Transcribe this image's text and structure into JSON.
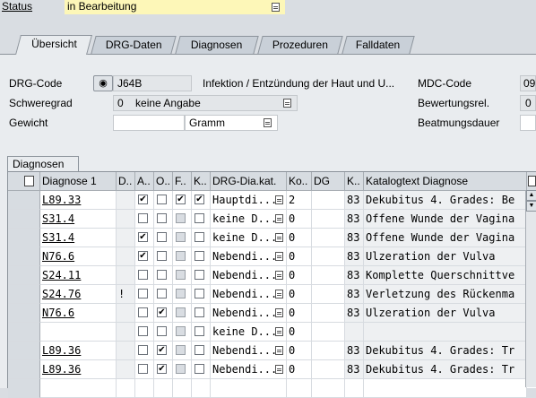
{
  "status": {
    "label": "Status",
    "value": "in Bearbeitung"
  },
  "tabs": [
    {
      "label": "Übersicht",
      "active": true
    },
    {
      "label": "DRG-Daten"
    },
    {
      "label": "Diagnosen"
    },
    {
      "label": "Prozeduren"
    },
    {
      "label": "Falldaten"
    }
  ],
  "form": {
    "drg_code_label": "DRG-Code",
    "drg_code_value": "J64B",
    "drg_description": "Infektion / Entzündung der Haut und U...",
    "mdc_code_label": "MDC-Code",
    "mdc_code_value": "09",
    "schweregrad_label": "Schweregrad",
    "schweregrad_value": "0",
    "schweregrad_text": "keine Angabe",
    "bewertungsrel_label": "Bewertungsrel.",
    "bewertungsrel_value": "0",
    "gewicht_label": "Gewicht",
    "gewicht_value": "",
    "gewicht_unit": "Gramm",
    "beatmungsdauer_label": "Beatmungsdauer"
  },
  "grid": {
    "title": "Diagnosen",
    "headers": [
      "Diagnose 1",
      "D..",
      "A..",
      "O..",
      "F..",
      "K..",
      "DRG-Dia.kat.",
      "Ko..",
      "DG",
      "K..",
      "Katalogtext Diagnose"
    ],
    "rows": [
      {
        "code": "L89.33",
        "d": "",
        "a": true,
        "o": false,
        "f": true,
        "k": true,
        "kat": "Hauptdi...",
        "ko": "2",
        "dg": "",
        "kk": "83",
        "text": "Dekubitus 4. Grades: Be"
      },
      {
        "code": "S31.4",
        "d": "",
        "a": false,
        "o": false,
        "f": null,
        "k": false,
        "kat": "keine D...",
        "ko": "0",
        "dg": "",
        "kk": "83",
        "text": "Offene Wunde der Vagina"
      },
      {
        "code": "S31.4",
        "d": "",
        "a": true,
        "o": false,
        "f": null,
        "k": false,
        "kat": "keine D...",
        "ko": "0",
        "dg": "",
        "kk": "83",
        "text": "Offene Wunde der Vagina"
      },
      {
        "code": "N76.6",
        "d": "",
        "a": true,
        "o": false,
        "f": null,
        "k": false,
        "kat": "Nebendi...",
        "ko": "0",
        "dg": "",
        "kk": "83",
        "text": "Ulzeration der Vulva"
      },
      {
        "code": "S24.11",
        "d": "",
        "a": false,
        "o": false,
        "f": null,
        "k": false,
        "kat": "Nebendi...",
        "ko": "0",
        "dg": "",
        "kk": "83",
        "text": "Komplette Querschnittve"
      },
      {
        "code": "S24.76",
        "d": "!",
        "a": false,
        "o": false,
        "f": null,
        "k": false,
        "kat": "Nebendi...",
        "ko": "0",
        "dg": "",
        "kk": "83",
        "text": "Verletzung des Rückenma"
      },
      {
        "code": "N76.6",
        "d": "",
        "a": false,
        "o": true,
        "f": null,
        "k": false,
        "kat": "Nebendi...",
        "ko": "0",
        "dg": "",
        "kk": "83",
        "text": "Ulzeration der Vulva"
      },
      {
        "code": "",
        "d": "",
        "a": false,
        "o": false,
        "f": null,
        "k": false,
        "kat": "keine D...",
        "ko": "0",
        "dg": "",
        "kk": "",
        "text": ""
      },
      {
        "code": "L89.36",
        "d": "",
        "a": false,
        "o": true,
        "f": null,
        "k": false,
        "kat": "Nebendi...",
        "ko": "0",
        "dg": "",
        "kk": "83",
        "text": "Dekubitus 4. Grades: Tr"
      },
      {
        "code": "L89.36",
        "d": "",
        "a": false,
        "o": true,
        "f": null,
        "k": false,
        "kat": "Nebendi...",
        "ko": "0",
        "dg": "",
        "kk": "83",
        "text": "Dekubitus 4. Grades: Tr"
      }
    ]
  }
}
